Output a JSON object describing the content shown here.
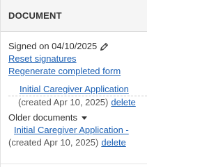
{
  "panel": {
    "title": "DOCUMENT"
  },
  "signature": {
    "signed_text": "Signed on 04/10/2025",
    "edit_icon": "pencil-icon",
    "reset_label": "Reset signatures",
    "regenerate_label": "Regenerate completed form"
  },
  "current_document": {
    "title": "Initial Caregiver Application",
    "created_text": "(created Apr 10, 2025)",
    "delete_label": "delete"
  },
  "older_documents": {
    "label": "Older documents",
    "toggle_icon": "caret-down-icon",
    "items": [
      {
        "title": "Initial Caregiver Application -",
        "created_text": "(created Apr 10, 2025)",
        "delete_label": "delete"
      }
    ]
  },
  "colors": {
    "link": "#1a5fb4",
    "header_bg": "#f5f5f5",
    "text": "#333333"
  }
}
